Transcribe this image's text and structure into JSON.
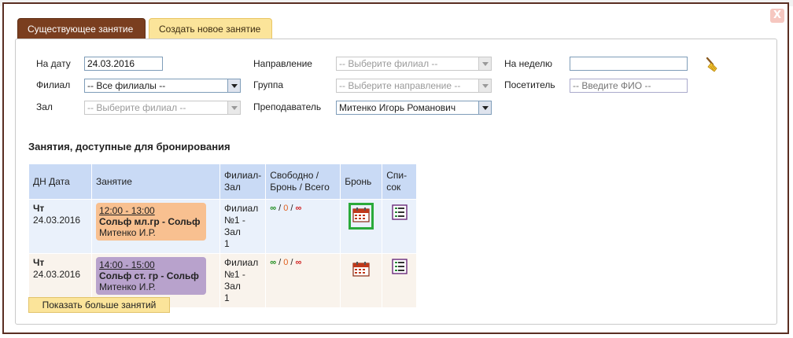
{
  "tabs": [
    {
      "label": "Существующее занятие",
      "active": true
    },
    {
      "label": "Создать новое занятие",
      "active": false
    }
  ],
  "close_label": "X",
  "filters": {
    "date": {
      "label": "На дату",
      "value": "24.03.2016"
    },
    "branch": {
      "label": "Филиал",
      "value": "-- Все филиалы --"
    },
    "hall": {
      "label": "Зал",
      "value": "-- Выберите филиал --"
    },
    "direction": {
      "label": "Направление",
      "value": "-- Выберите филиал --"
    },
    "group": {
      "label": "Группа",
      "value": "-- Выберите направление --"
    },
    "teacher": {
      "label": "Преподаватель",
      "value": "Митенко Игорь Романович"
    },
    "week": {
      "label": "На неделю",
      "value": ""
    },
    "visitor": {
      "label": "Посетитель",
      "placeholder": "-- Введите ФИО --"
    }
  },
  "section_title": "Занятия, доступные для бронирования",
  "table": {
    "headers": [
      "ДН Дата",
      "Занятие",
      "Филиал-Зал",
      "Свободно / Бронь / Всего",
      "Бронь",
      "Спи-сок"
    ],
    "header_lines": {
      "branch": [
        "Филиал-",
        "Зал"
      ],
      "free": [
        "Свободно /",
        "Бронь / Всего"
      ],
      "list": [
        "Спи-",
        "сок"
      ]
    },
    "rows": [
      {
        "day": "Чт",
        "date": "24.03.2016",
        "time": "12:00 - 13:00",
        "lesson": "Сольф мл.гр - Сольф",
        "teacher": "Митенко И.Р.",
        "color": "#f8c090",
        "branch_lines": [
          "Филиал",
          "№1 - Зал",
          "1"
        ],
        "free": "∞",
        "booked": "0",
        "total": "∞",
        "highlight": true
      },
      {
        "day": "Чт",
        "date": "24.03.2016",
        "time": "14:00 - 15:00",
        "lesson": "Сольф ст. гр - Сольф",
        "teacher": "Митенко И.Р.",
        "color": "#b8a2cc",
        "branch_lines": [
          "Филиал",
          "№1 - Зал",
          "1"
        ],
        "free": "∞",
        "booked": "0",
        "total": "∞",
        "highlight": false
      }
    ],
    "separator": "/"
  },
  "more_button": "Показать больше занятий",
  "icons": {
    "booking": "calendar-icon",
    "list": "list-icon",
    "clear": "broom-icon"
  },
  "colors": {
    "tab_active": "#7a3e1f",
    "tab_inactive": "#fbe49a",
    "header_bg": "#c9daf5",
    "highlight": "#2aaa3a"
  }
}
